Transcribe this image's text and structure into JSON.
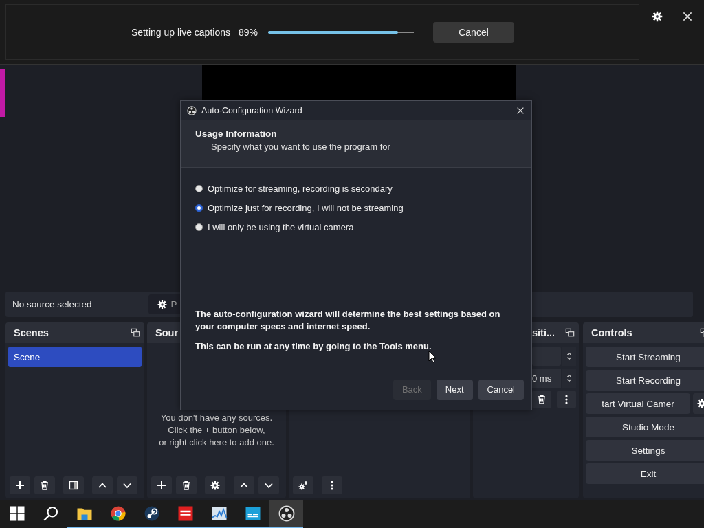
{
  "captions_bar": {
    "label": "Setting up live captions",
    "percent": "89%",
    "level": 0.89,
    "cancel": "Cancel"
  },
  "source_toolbar": {
    "status": "No source selected",
    "properties_button": "P"
  },
  "docks": {
    "scenes": {
      "title": "Scenes",
      "items": [
        {
          "label": "Scene",
          "selected": true
        }
      ]
    },
    "sources": {
      "title": "Sour",
      "empty_lines": [
        "You don't have any sources.",
        "Click the + button below,",
        "or right click here to add one."
      ]
    },
    "transitions": {
      "title": "siti...",
      "duration": "0 ms"
    },
    "controls": {
      "title": "Controls",
      "buttons": [
        {
          "label": "Start Streaming",
          "has_settings": false
        },
        {
          "label": "Start Recording",
          "has_settings": false
        },
        {
          "label": "tart Virtual Camer",
          "has_settings": true
        },
        {
          "label": "Studio Mode",
          "has_settings": false
        },
        {
          "label": "Settings",
          "has_settings": false
        },
        {
          "label": "Exit",
          "has_settings": false
        }
      ]
    }
  },
  "dialog": {
    "title": "Auto-Configuration Wizard",
    "heading": "Usage Information",
    "subheading": "Specify what you want to use the program for",
    "options": [
      {
        "label": "Optimize for streaming, recording is secondary",
        "selected": false
      },
      {
        "label": "Optimize just for recording, I will not be streaming",
        "selected": true
      },
      {
        "label": "I will only be using the virtual camera",
        "selected": false
      }
    ],
    "notes": [
      "The auto-configuration wizard will determine the best settings based on your computer specs and internet speed.",
      "This can be run at any time by going to the Tools menu."
    ],
    "buttons": [
      {
        "label": "Back",
        "disabled": true
      },
      {
        "label": "Next",
        "disabled": false
      },
      {
        "label": "Cancel",
        "disabled": false
      }
    ]
  },
  "taskbar": {
    "apps": [
      {
        "kind": "folder",
        "running": true,
        "selected": false
      },
      {
        "kind": "browser",
        "running": true,
        "selected": false
      },
      {
        "kind": "steam",
        "running": true,
        "selected": false
      },
      {
        "kind": "red",
        "running": true,
        "selected": false
      },
      {
        "kind": "chart",
        "running": true,
        "selected": false
      },
      {
        "kind": "screen",
        "running": true,
        "selected": false
      },
      {
        "kind": "obs",
        "running": true,
        "selected": true
      }
    ]
  }
}
